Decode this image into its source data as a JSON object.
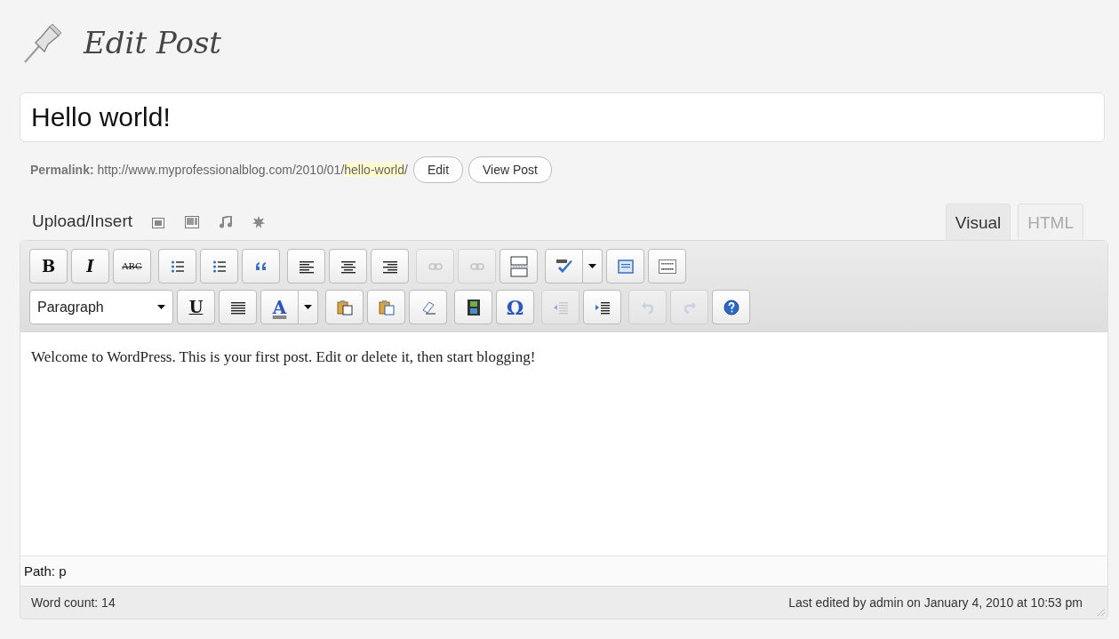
{
  "heading": "Edit Post",
  "title_field": {
    "value": "Hello world!"
  },
  "permalink": {
    "label": "Permalink:",
    "base": "http://www.myprofessionalblog.com/2010/01/",
    "slug": "hello-world",
    "trail": "/",
    "buttons": [
      "Edit",
      "View Post"
    ]
  },
  "upload": {
    "label": "Upload/Insert",
    "items": [
      {
        "kind": "image"
      },
      {
        "kind": "video"
      },
      {
        "kind": "audio"
      },
      {
        "kind": "media"
      }
    ]
  },
  "tabs": [
    {
      "label": "Visual",
      "selected": true
    },
    {
      "label": "HTML",
      "selected": false
    }
  ],
  "toolbar_rows": [
    [
      [
        {
          "kind": "bold",
          "glyph": "B",
          "disabled": false
        },
        {
          "kind": "italic",
          "glyph": "I",
          "disabled": false
        },
        {
          "kind": "strike",
          "glyph": "ABC",
          "disabled": false
        }
      ],
      [
        {
          "kind": "bullets",
          "disabled": false
        },
        {
          "kind": "numbers",
          "disabled": false
        },
        {
          "kind": "quote",
          "disabled": false
        }
      ],
      [
        {
          "kind": "align-left",
          "disabled": false
        },
        {
          "kind": "align-center",
          "disabled": false
        },
        {
          "kind": "align-right",
          "disabled": false
        }
      ],
      [
        {
          "kind": "link",
          "disabled": true
        },
        {
          "kind": "unlink",
          "disabled": true
        },
        {
          "kind": "more",
          "disabled": false
        }
      ],
      [
        {
          "kind": "spell",
          "disabled": false
        },
        {
          "kind": "fullscreen",
          "disabled": false
        },
        {
          "kind": "kitchen",
          "disabled": false
        }
      ]
    ],
    [
      [
        {
          "kind": "format",
          "glyph": "Paragraph",
          "disabled": false
        },
        {
          "kind": "underline",
          "glyph": "U",
          "disabled": false
        },
        {
          "kind": "justify",
          "disabled": false
        },
        {
          "kind": "color",
          "glyph": "A",
          "disabled": false
        }
      ],
      [
        {
          "kind": "paste-text",
          "disabled": false
        },
        {
          "kind": "paste-word",
          "disabled": false
        },
        {
          "kind": "eraser",
          "disabled": false
        }
      ],
      [
        {
          "kind": "film",
          "disabled": false
        },
        {
          "kind": "omega",
          "glyph": "Ω",
          "disabled": false
        }
      ],
      [
        {
          "kind": "outdent",
          "disabled": true
        },
        {
          "kind": "indent",
          "disabled": false
        }
      ],
      [
        {
          "kind": "undo",
          "disabled": true
        },
        {
          "kind": "redo",
          "disabled": true
        },
        {
          "kind": "help",
          "disabled": false
        }
      ]
    ]
  ],
  "content": "Welcome to WordPress. This is your first post. Edit or delete it, then start blogging!",
  "path": "Path: p",
  "status": {
    "word_count": "Word count: 14",
    "last_edited": "Last edited by admin on January 4, 2010 at 10:53 pm"
  }
}
